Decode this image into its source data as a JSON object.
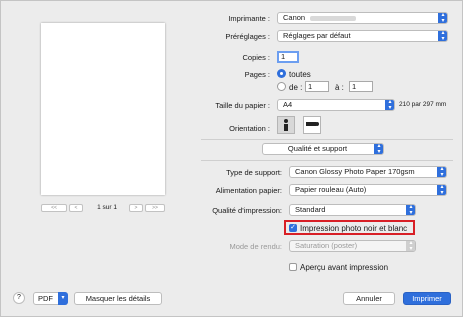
{
  "printer": {
    "label": "Imprimante :",
    "value": "Canon"
  },
  "presets": {
    "label": "Préréglages :",
    "value": "Réglages par défaut"
  },
  "copies": {
    "label": "Copies :",
    "value": "1"
  },
  "pages": {
    "label": "Pages :",
    "all_label": "toutes",
    "from_label": "de :",
    "from_value": "1",
    "to_label": "à :",
    "to_value": "1"
  },
  "paper_size": {
    "label": "Taille du papier :",
    "value": "A4",
    "dimensions": "210 par 297 mm"
  },
  "orientation": {
    "label": "Orientation :"
  },
  "panel": {
    "value": "Qualité et support"
  },
  "media_type": {
    "label": "Type de support:",
    "value": "Canon Glossy Photo Paper 170gsm"
  },
  "paper_source": {
    "label": "Alimentation papier:",
    "value": "Papier rouleau (Auto)"
  },
  "print_quality": {
    "label": "Qualité d'impression:",
    "value": "Standard"
  },
  "bw_photo": {
    "label": "Impression photo noir et blanc",
    "checked": true
  },
  "render_mode": {
    "label": "Mode de rendu:",
    "value": "Saturation (poster)"
  },
  "preview_option": {
    "label": "Aperçu avant impression",
    "checked": false
  },
  "preview_nav": {
    "page_text": "1 sur 1"
  },
  "footer": {
    "help": "?",
    "pdf": "PDF",
    "hide_details": "Masquer les détails",
    "cancel": "Annuler",
    "print": "Imprimer"
  },
  "colors": {
    "accent": "#2f6fdc",
    "highlight_box": "#d81f26"
  }
}
